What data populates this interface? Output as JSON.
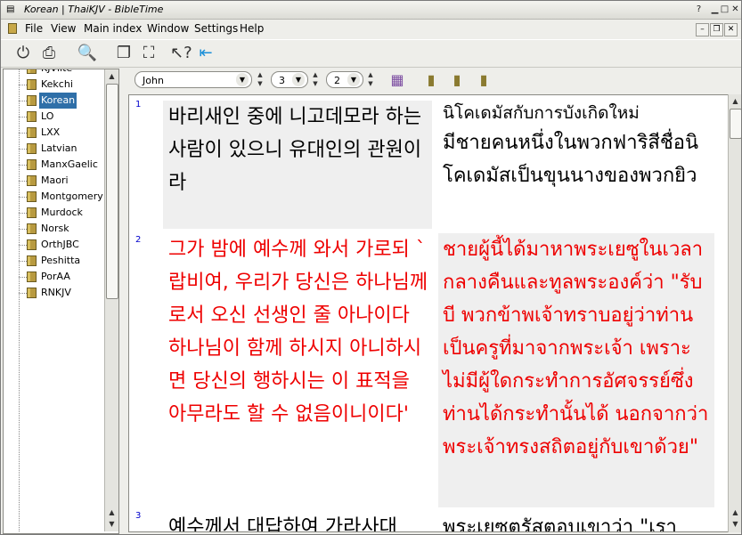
{
  "window": {
    "title": "Korean | ThaiKJV - BibleTime",
    "buttons": [
      "help",
      "minimize",
      "maximize",
      "close"
    ]
  },
  "menubar": {
    "items": [
      "File",
      "View",
      "Main index",
      "Window",
      "Settings",
      "Help"
    ]
  },
  "toolbar": {
    "icons": [
      "power-icon",
      "print-icon",
      "search-icon",
      "cascade-windows-icon",
      "fullscreen-icon",
      "whats-this-icon",
      "back-arrow-icon"
    ]
  },
  "module_tree": {
    "items": [
      "KJVlite",
      "Kekchi",
      "Korean",
      "LO",
      "LXX",
      "Latvian",
      "ManxGaelic",
      "Maori",
      "Montgomery",
      "Murdock",
      "Norsk",
      "OrthJBC",
      "Peshitta",
      "PorAA",
      "RNKJV"
    ],
    "selected": "Korean"
  },
  "reader": {
    "book": "John",
    "chapter": "3",
    "verse": "2",
    "verses": [
      {
        "num": "1",
        "korean": "바리새인 중에 니고데모라 하는 사람이 있으니 유대인의 관원이라",
        "thai_heading": "นิโคเดมัสกับการบังเกิดใหม่",
        "thai": "มีชายคนหนึ่งในพวกฟาริสีชื่อนิโคเดมัสเป็นขุนนางของพวกยิว"
      },
      {
        "num": "2",
        "korean": "그가 밤에 예수께 와서 가로되 `랍비여, 우리가 당신은 하나님께로서 오신 선생인 줄 아나이다 하나님이 함께 하시지 아니하시면 당신의 행하시는 이 표적을 아무라도 할 수 없음이니이다'",
        "thai": "ชายผู้นี้ได้มาหาพระเยซูในเวลากลางคืนและทูลพระองค์ว่า \"รับบี พวกข้าพเจ้าทราบอยู่ว่าท่านเป็นครูที่มาจากพระเจ้า เพราะไม่มีผู้ใดกระทำการอัศจรรย์ซึ่งท่านได้กระทำนั้นได้ นอกจากว่าพระเจ้าทรงสถิตอยู่กับเขาด้วย\""
      },
      {
        "num": "3",
        "korean": "예수께서 대답하여 가라사대",
        "thai": "พระเยซูตรัสตอบเขาว่า \"เรา"
      }
    ]
  }
}
